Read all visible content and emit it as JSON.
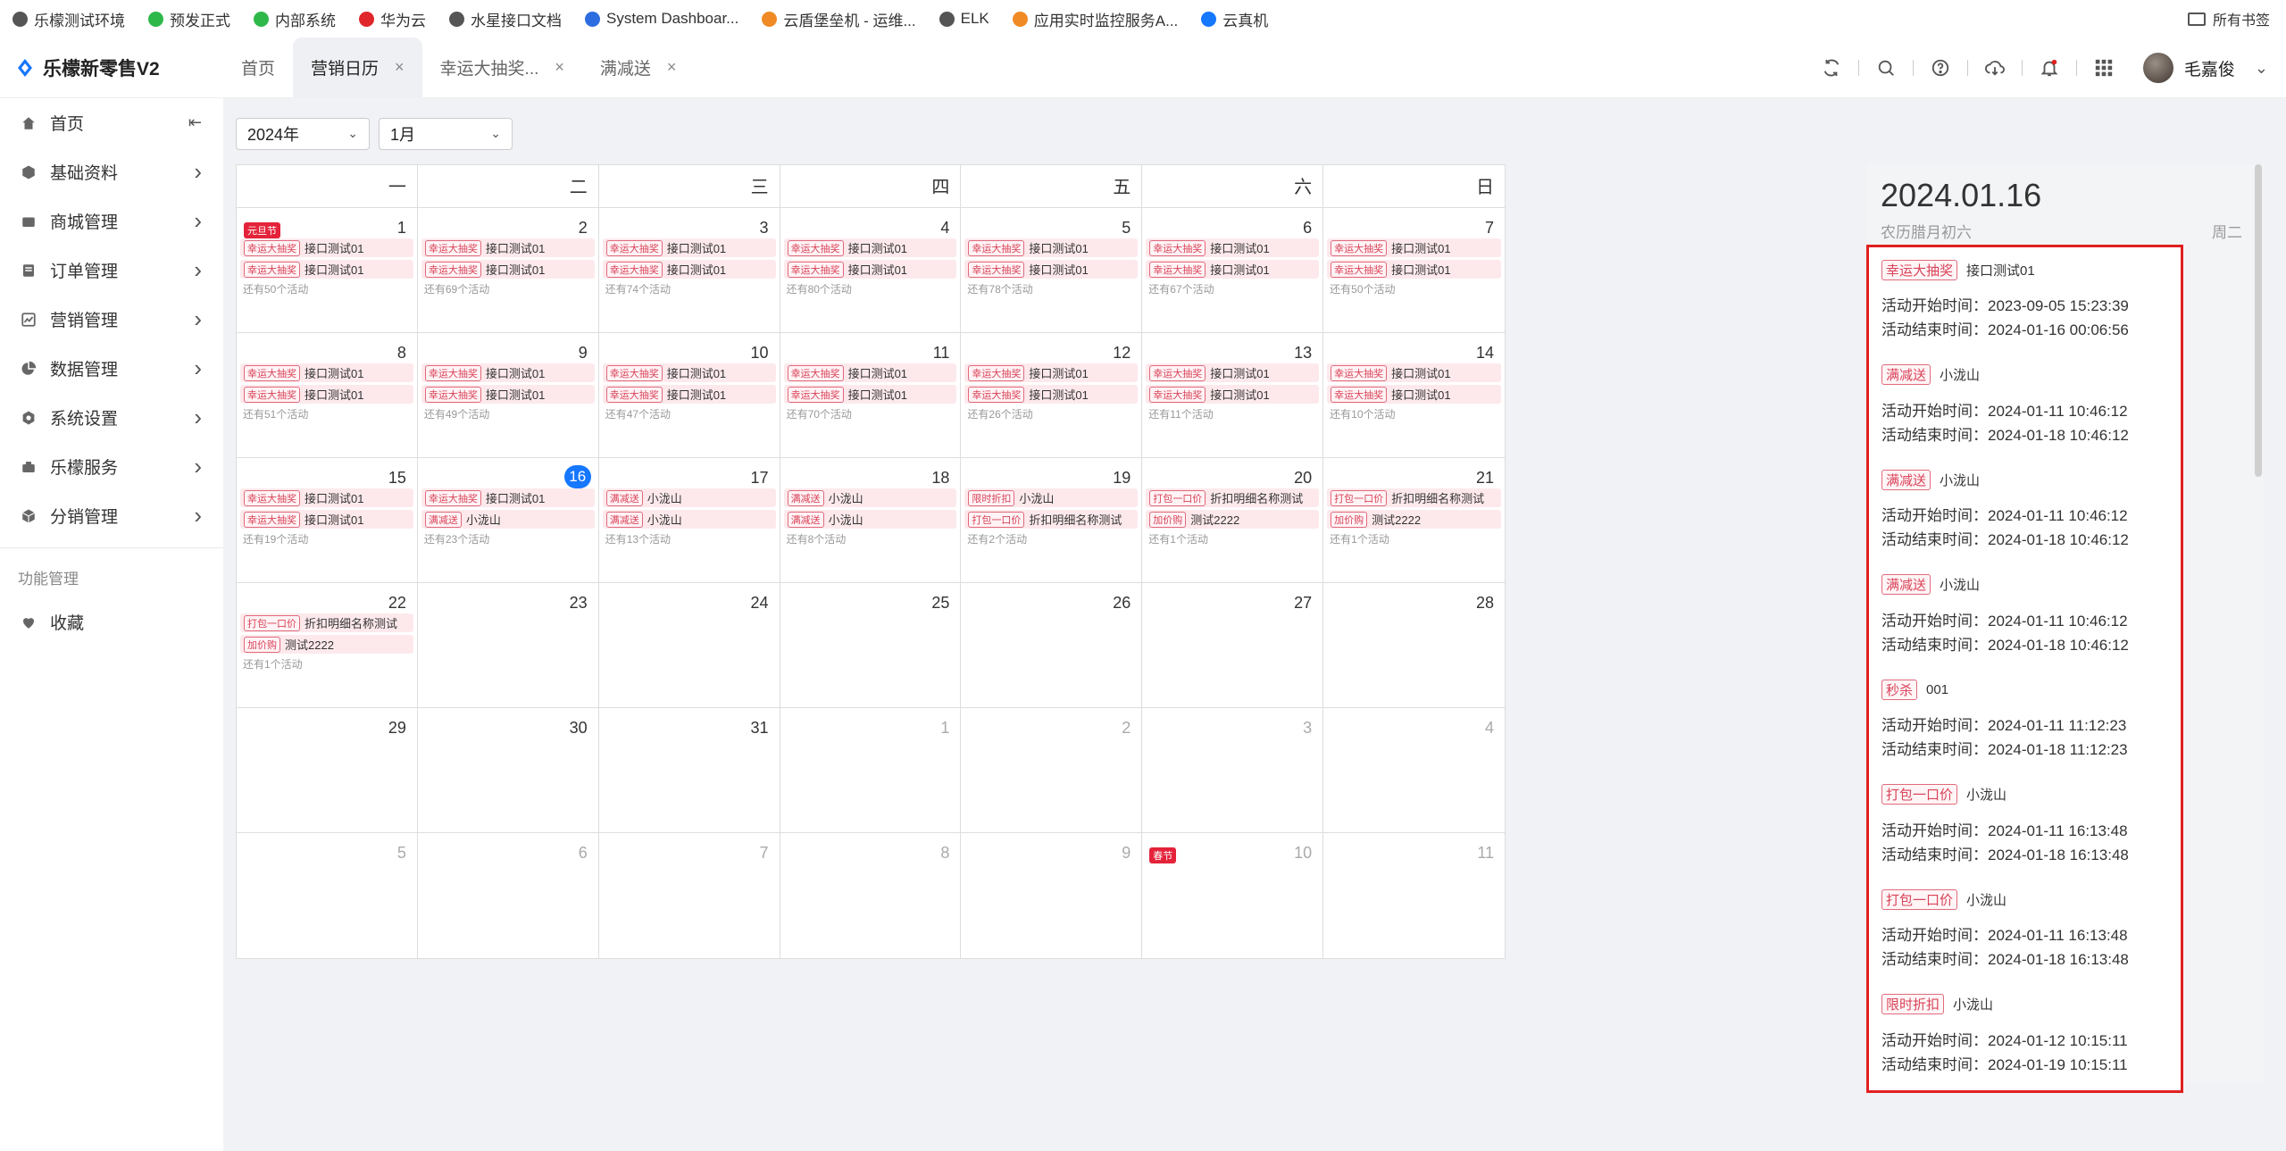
{
  "bookmarks": [
    {
      "label": "乐檬测试环境",
      "color": "#555555"
    },
    {
      "label": "预发正式",
      "color": "#2eb84a"
    },
    {
      "label": "内部系统",
      "color": "#2eb84a"
    },
    {
      "label": "华为云",
      "color": "#e0262a"
    },
    {
      "label": "水星接口文档",
      "color": "#555555"
    },
    {
      "label": "System Dashboar...",
      "color": "#2d6de0"
    },
    {
      "label": "云盾堡垒机 - 运维...",
      "color": "#f08a24"
    },
    {
      "label": "ELK",
      "color": "#555555"
    },
    {
      "label": "应用实时监控服务A...",
      "color": "#f08a24"
    },
    {
      "label": "云真机",
      "color": "#1677ff"
    }
  ],
  "bookmarks_right": "所有书签",
  "app": {
    "title": "乐檬新零售V2",
    "user": "毛嘉俊",
    "brand_color": "#1677ff"
  },
  "tabs": [
    {
      "label": "首页",
      "closable": false,
      "active": false
    },
    {
      "label": "营销日历",
      "closable": true,
      "active": true
    },
    {
      "label": "幸运大抽奖...",
      "closable": true,
      "active": false
    },
    {
      "label": "满减送",
      "closable": true,
      "active": false
    }
  ],
  "sidebar": {
    "items": [
      {
        "label": "首页",
        "icon": "home-icon"
      },
      {
        "label": "基础资料",
        "icon": "cube-icon"
      },
      {
        "label": "商城管理",
        "icon": "store-icon"
      },
      {
        "label": "订单管理",
        "icon": "order-icon"
      },
      {
        "label": "营销管理",
        "icon": "chart-icon"
      },
      {
        "label": "数据管理",
        "icon": "pie-icon"
      },
      {
        "label": "系统设置",
        "icon": "settings-icon"
      },
      {
        "label": "乐檬服务",
        "icon": "service-icon"
      },
      {
        "label": "分销管理",
        "icon": "distribution-icon"
      }
    ],
    "section_title": "功能管理",
    "favorites": "收藏"
  },
  "filters": {
    "year": "2024年",
    "month": "1月"
  },
  "calendar": {
    "weekdays": [
      "一",
      "二",
      "三",
      "四",
      "五",
      "六",
      "日"
    ],
    "days": [
      {
        "d": "1",
        "holiday": "元旦节",
        "events": [
          [
            "幸运大抽奖",
            "接口测试01"
          ],
          [
            "幸运大抽奖",
            "接口测试01"
          ]
        ],
        "more": "还有50个活动"
      },
      {
        "d": "2",
        "events": [
          [
            "幸运大抽奖",
            "接口测试01"
          ],
          [
            "幸运大抽奖",
            "接口测试01"
          ]
        ],
        "more": "还有69个活动"
      },
      {
        "d": "3",
        "events": [
          [
            "幸运大抽奖",
            "接口测试01"
          ],
          [
            "幸运大抽奖",
            "接口测试01"
          ]
        ],
        "more": "还有74个活动"
      },
      {
        "d": "4",
        "events": [
          [
            "幸运大抽奖",
            "接口测试01"
          ],
          [
            "幸运大抽奖",
            "接口测试01"
          ]
        ],
        "more": "还有80个活动"
      },
      {
        "d": "5",
        "events": [
          [
            "幸运大抽奖",
            "接口测试01"
          ],
          [
            "幸运大抽奖",
            "接口测试01"
          ]
        ],
        "more": "还有78个活动"
      },
      {
        "d": "6",
        "events": [
          [
            "幸运大抽奖",
            "接口测试01"
          ],
          [
            "幸运大抽奖",
            "接口测试01"
          ]
        ],
        "more": "还有67个活动"
      },
      {
        "d": "7",
        "events": [
          [
            "幸运大抽奖",
            "接口测试01"
          ],
          [
            "幸运大抽奖",
            "接口测试01"
          ]
        ],
        "more": "还有50个活动"
      },
      {
        "d": "8",
        "events": [
          [
            "幸运大抽奖",
            "接口测试01"
          ],
          [
            "幸运大抽奖",
            "接口测试01"
          ]
        ],
        "more": "还有51个活动"
      },
      {
        "d": "9",
        "events": [
          [
            "幸运大抽奖",
            "接口测试01"
          ],
          [
            "幸运大抽奖",
            "接口测试01"
          ]
        ],
        "more": "还有49个活动"
      },
      {
        "d": "10",
        "events": [
          [
            "幸运大抽奖",
            "接口测试01"
          ],
          [
            "幸运大抽奖",
            "接口测试01"
          ]
        ],
        "more": "还有47个活动"
      },
      {
        "d": "11",
        "events": [
          [
            "幸运大抽奖",
            "接口测试01"
          ],
          [
            "幸运大抽奖",
            "接口测试01"
          ]
        ],
        "more": "还有70个活动"
      },
      {
        "d": "12",
        "events": [
          [
            "幸运大抽奖",
            "接口测试01"
          ],
          [
            "幸运大抽奖",
            "接口测试01"
          ]
        ],
        "more": "还有26个活动"
      },
      {
        "d": "13",
        "events": [
          [
            "幸运大抽奖",
            "接口测试01"
          ],
          [
            "幸运大抽奖",
            "接口测试01"
          ]
        ],
        "more": "还有11个活动"
      },
      {
        "d": "14",
        "events": [
          [
            "幸运大抽奖",
            "接口测试01"
          ],
          [
            "幸运大抽奖",
            "接口测试01"
          ]
        ],
        "more": "还有10个活动"
      },
      {
        "d": "15",
        "events": [
          [
            "幸运大抽奖",
            "接口测试01"
          ],
          [
            "幸运大抽奖",
            "接口测试01"
          ]
        ],
        "more": "还有19个活动"
      },
      {
        "d": "16",
        "today": true,
        "events": [
          [
            "幸运大抽奖",
            "接口测试01"
          ],
          [
            "满减送",
            "小泷山"
          ]
        ],
        "more": "还有23个活动"
      },
      {
        "d": "17",
        "events": [
          [
            "满减送",
            "小泷山"
          ],
          [
            "满减送",
            "小泷山"
          ]
        ],
        "more": "还有13个活动"
      },
      {
        "d": "18",
        "events": [
          [
            "满减送",
            "小泷山"
          ],
          [
            "满减送",
            "小泷山"
          ]
        ],
        "more": "还有8个活动"
      },
      {
        "d": "19",
        "events": [
          [
            "限时折扣",
            "小泷山"
          ],
          [
            "打包一口价",
            "折扣明细名称测试"
          ]
        ],
        "more": "还有2个活动"
      },
      {
        "d": "20",
        "events": [
          [
            "打包一口价",
            "折扣明细名称测试"
          ],
          [
            "加价购",
            "测试2222"
          ]
        ],
        "more": "还有1个活动"
      },
      {
        "d": "21",
        "events": [
          [
            "打包一口价",
            "折扣明细名称测试"
          ],
          [
            "加价购",
            "测试2222"
          ]
        ],
        "more": "还有1个活动"
      },
      {
        "d": "22",
        "events": [
          [
            "打包一口价",
            "折扣明细名称测试"
          ],
          [
            "加价购",
            "测试2222"
          ]
        ],
        "more": "还有1个活动"
      },
      {
        "d": "23",
        "events": []
      },
      {
        "d": "24",
        "events": []
      },
      {
        "d": "25",
        "events": []
      },
      {
        "d": "26",
        "events": []
      },
      {
        "d": "27",
        "events": []
      },
      {
        "d": "28",
        "events": []
      },
      {
        "d": "29",
        "events": []
      },
      {
        "d": "30",
        "events": []
      },
      {
        "d": "31",
        "events": []
      },
      {
        "d": "1",
        "other": true,
        "events": []
      },
      {
        "d": "2",
        "other": true,
        "events": []
      },
      {
        "d": "3",
        "other": true,
        "events": []
      },
      {
        "d": "4",
        "other": true,
        "events": []
      },
      {
        "d": "5",
        "other": true,
        "events": []
      },
      {
        "d": "6",
        "other": true,
        "events": []
      },
      {
        "d": "7",
        "other": true,
        "events": []
      },
      {
        "d": "8",
        "other": true,
        "events": []
      },
      {
        "d": "9",
        "other": true,
        "events": []
      },
      {
        "d": "10",
        "other": true,
        "holiday": "春节",
        "events": []
      },
      {
        "d": "11",
        "other": true,
        "events": []
      }
    ]
  },
  "detail": {
    "date": "2024.01.16",
    "lunar": "农历腊月初六",
    "weekday": "周二",
    "start_label": "活动开始时间：",
    "end_label": "活动结束时间：",
    "activities": [
      {
        "tag": "幸运大抽奖",
        "name": "接口测试01",
        "start": "2023-09-05 15:23:39",
        "end": "2024-01-16 00:06:56"
      },
      {
        "tag": "满减送",
        "name": "小泷山",
        "start": "2024-01-11 10:46:12",
        "end": "2024-01-18 10:46:12"
      },
      {
        "tag": "满减送",
        "name": "小泷山",
        "start": "2024-01-11 10:46:12",
        "end": "2024-01-18 10:46:12"
      },
      {
        "tag": "满减送",
        "name": "小泷山",
        "start": "2024-01-11 10:46:12",
        "end": "2024-01-18 10:46:12"
      },
      {
        "tag": "秒杀",
        "name": "001",
        "start": "2024-01-11 11:12:23",
        "end": "2024-01-18 11:12:23"
      },
      {
        "tag": "打包一口价",
        "name": "小泷山",
        "start": "2024-01-11 16:13:48",
        "end": "2024-01-18 16:13:48"
      },
      {
        "tag": "打包一口价",
        "name": "小泷山",
        "start": "2024-01-11 16:13:48",
        "end": "2024-01-18 16:13:48"
      },
      {
        "tag": "限时折扣",
        "name": "小泷山",
        "start": "2024-01-12 10:15:11",
        "end": "2024-01-19 10:15:11"
      }
    ]
  }
}
